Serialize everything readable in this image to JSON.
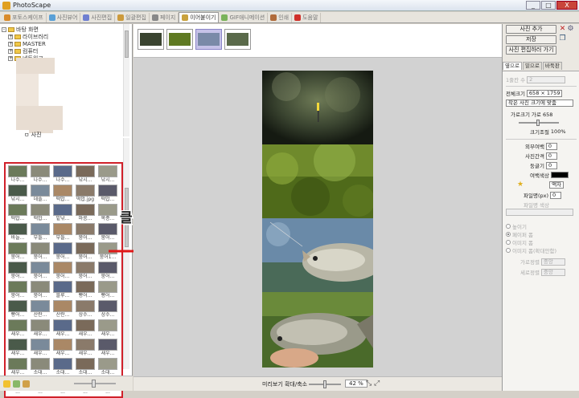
{
  "window": {
    "title": "PhotoScape",
    "min": "_",
    "max": "□",
    "close": "X"
  },
  "tabs": [
    {
      "label": "포토스케이프",
      "color": "#d98b2b",
      "active": false
    },
    {
      "label": "사진뷰어",
      "color": "#5aa0d6",
      "active": false
    },
    {
      "label": "사진편집",
      "color": "#6f7fd1",
      "active": false
    },
    {
      "label": "일괄편집",
      "color": "#cc9a3c",
      "active": false
    },
    {
      "label": "페이지",
      "color": "#888888",
      "active": false
    },
    {
      "label": "이어붙이기",
      "color": "#c9a23d",
      "active": true
    },
    {
      "label": "GIF애니메이션",
      "color": "#7ab35a",
      "active": false
    },
    {
      "label": "인쇄",
      "color": "#b06b3b",
      "active": false
    },
    {
      "label": "도움말",
      "color": "#d0302a",
      "active": false
    }
  ],
  "tree": [
    {
      "label": "바탕 화면",
      "indent": 0,
      "exp": "-"
    },
    {
      "label": "라이브러리",
      "indent": 1,
      "exp": "+"
    },
    {
      "label": "MASTER",
      "indent": 1,
      "exp": "+"
    },
    {
      "label": "컴퓨터",
      "indent": 1,
      "exp": "+"
    },
    {
      "label": "네트워크",
      "indent": 1,
      "exp": "+"
    }
  ],
  "tree_partial": "ㅁ 사진",
  "thumbnails": [
    "나수...",
    "나수...",
    "나수...",
    "낚시...",
    "낚시...",
    "낚시...",
    "데플...",
    "떡밥...",
    "떡밥.jpg",
    "떡밥...",
    "떡밥...",
    "떡밥...",
    "밑낚...",
    "마릉...",
    "목종...",
    "바늘...",
    "부들...",
    "부들...",
    "붕어...",
    "붕어...",
    "붕어...",
    "붕어...",
    "붕어...",
    "붕어...",
    "붕어1...",
    "붕어...",
    "붕어...",
    "붕어...",
    "붕어...",
    "붕어...",
    "붕어...",
    "붕어...",
    "블루...",
    "빵어...",
    "빵어...",
    "빵어...",
    "산란...",
    "산란...",
    "상수...",
    "상수...",
    "새우...",
    "새우...",
    "새우...",
    "새우...",
    "새우...",
    "새우...",
    "새우...",
    "새우...",
    "새우...",
    "새우...",
    "새우...",
    "소대...",
    "소대...",
    "소대...",
    "소대...",
    "...",
    "...",
    "...",
    "...",
    "..."
  ],
  "thumb_colors": [
    "#6b7a5a",
    "#8a8a7a",
    "#5a6a8a",
    "#7a6a5a",
    "#9a9a8a",
    "#4a5a4a",
    "#7a8a9a",
    "#aa8866",
    "#8a7a6a",
    "#5a5a6a"
  ],
  "annotation": "클릭해서 이동",
  "strip_count": 4,
  "canvas_bg": "#d2d2d2",
  "bottom": {
    "zoom_label": "미리보기 확대/축소",
    "zoom_value": "42 %",
    "zoom_fraction": 0.5
  },
  "right": {
    "buttons": [
      "사진 추가",
      "저장",
      "사진 편집하러 가기"
    ],
    "tabs": [
      {
        "label": "옆으로",
        "active": true
      },
      {
        "label": "밑으로",
        "active": false
      },
      {
        "label": "바둑판",
        "active": false
      }
    ],
    "columns_label": "1줄칸 수",
    "columns_value": "2",
    "total_size_label": "전체크기",
    "total_size_value": "658 × 1759",
    "fit_option": "작은 사진 크기에 맞춤",
    "width_label": "가로크기",
    "width_value": "가로 658",
    "resize_label": "크기조절",
    "resize_value": "100%",
    "outer_margin_label": "외부여백",
    "outer_margin_value": "0",
    "spacing_label": "사진간격",
    "spacing_value": "0",
    "rounding_label": "둥글기",
    "rounding_value": "0",
    "margin_color_label": "여백색상",
    "frame_label": "액자",
    "frame_line_label": "파일명(px)",
    "frame_line_value": "0",
    "frame_style_label": "파일명 색상",
    "layout_label": "높이기",
    "radios": [
      {
        "label": "높이기",
        "on": false
      },
      {
        "label": "페이퍼 폼",
        "on": true
      },
      {
        "label": "이미지 폼",
        "on": false
      },
      {
        "label": "이미지 폼(확대안함)",
        "on": false
      }
    ],
    "halign_label": "가로정렬",
    "halign_value": "중앙",
    "valign_label": "세로정렬",
    "valign_value": "중앙"
  }
}
